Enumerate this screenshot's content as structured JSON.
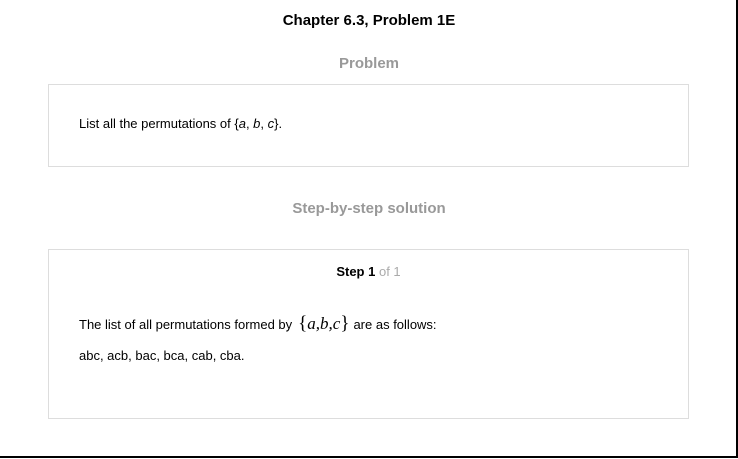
{
  "header": {
    "title": "Chapter 6.3, Problem 1E"
  },
  "problem": {
    "heading": "Problem",
    "text_prefix": "List all the permutations of {",
    "a": "a",
    "sep1": ", ",
    "b": "b",
    "sep2": ", ",
    "c": "c",
    "text_suffix": "}."
  },
  "solution": {
    "heading": "Step-by-step solution",
    "step_label": "Step 1",
    "step_of": "of 1",
    "line1_prefix": "The list of all permutations formed by",
    "math_open": "{",
    "math_body": "a,b,c",
    "math_close": "}",
    "line1_suffix": "are as follows:",
    "line2": "abc, acb, bac, bca, cab, cba."
  }
}
